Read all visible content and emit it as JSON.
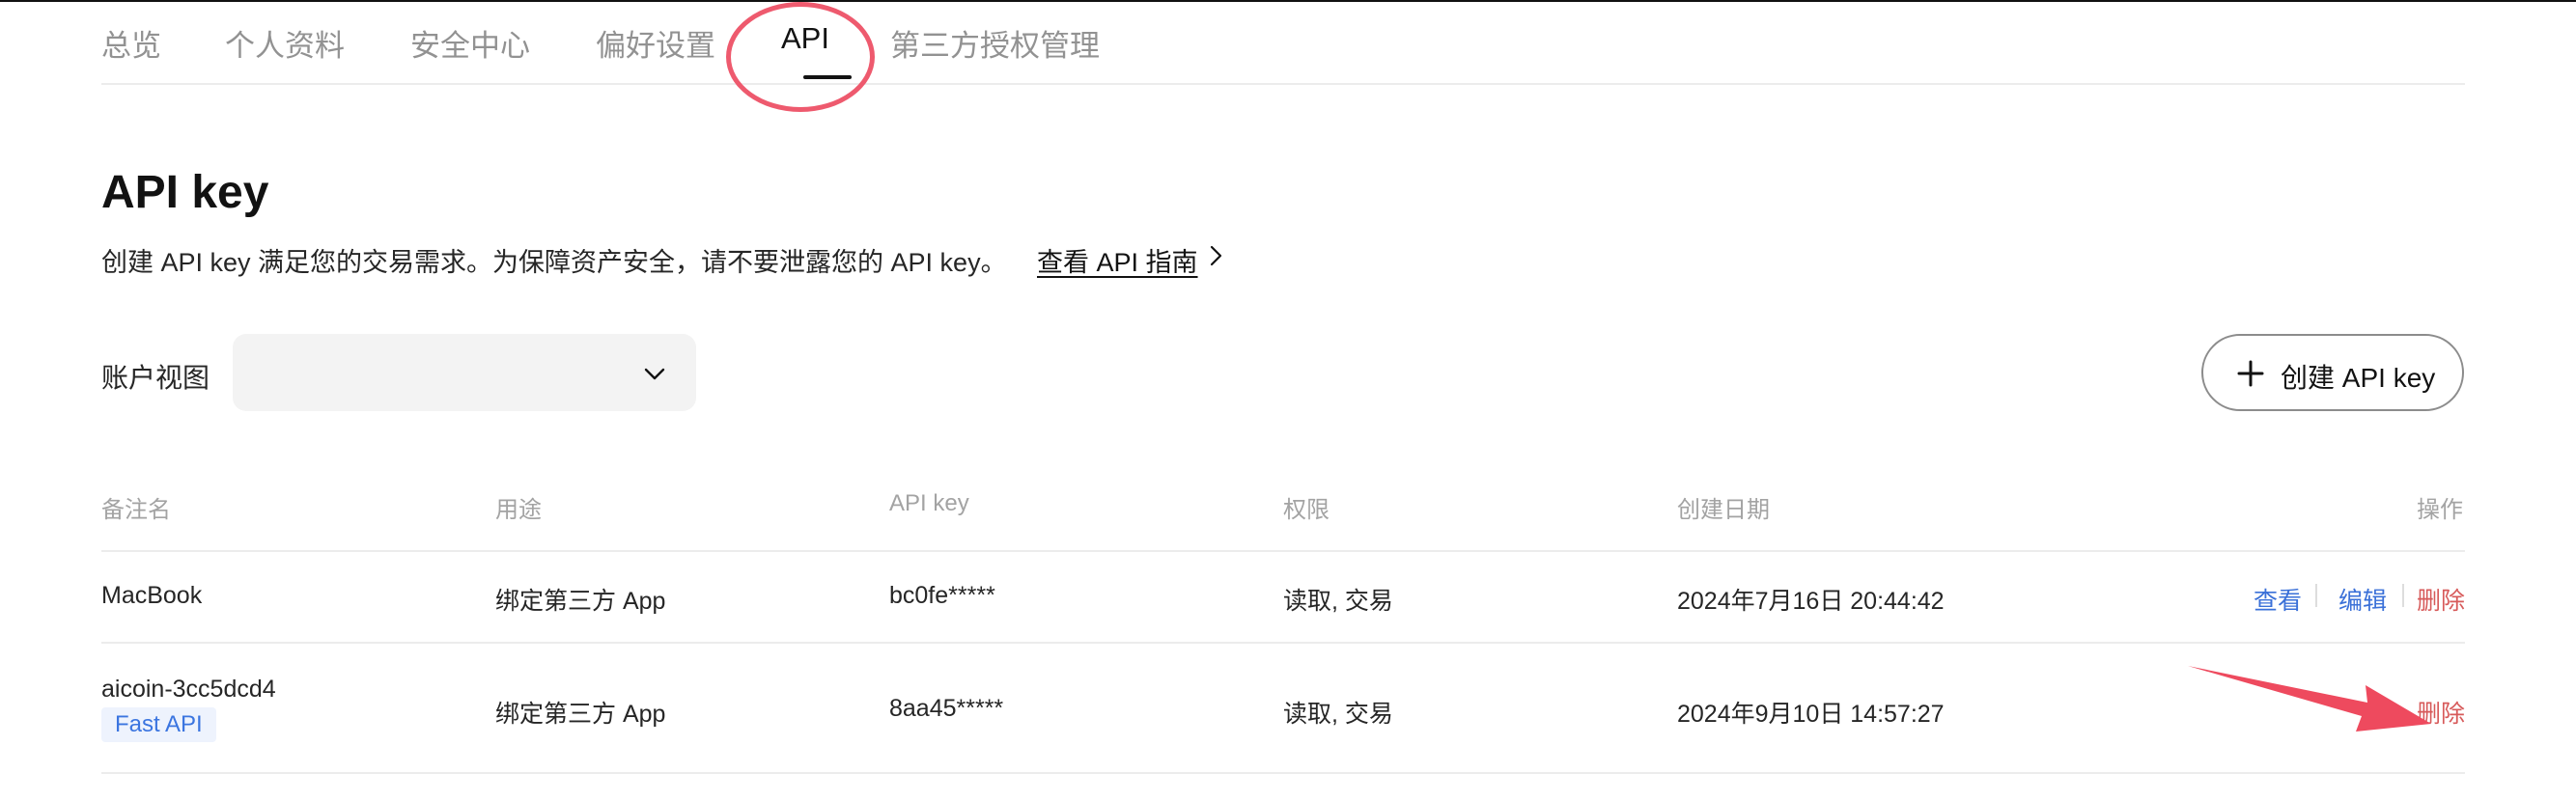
{
  "tabs": [
    {
      "label": "总览"
    },
    {
      "label": "个人资料"
    },
    {
      "label": "安全中心"
    },
    {
      "label": "偏好设置"
    },
    {
      "label": "API",
      "active": true
    },
    {
      "label": "第三方授权管理"
    }
  ],
  "header": {
    "title": "API key",
    "description": "创建 API key 满足您的交易需求。为保障资产安全，请不要泄露您的 API key。",
    "guide_link": "查看 API 指南"
  },
  "account_view": {
    "label": "账户视图",
    "selected": ""
  },
  "create_button": {
    "label": "创建 API key"
  },
  "table": {
    "columns": [
      "备注名",
      "用途",
      "API key",
      "权限",
      "创建日期",
      "操作"
    ],
    "rows": [
      {
        "name": "MacBook",
        "tag": "",
        "usage": "绑定第三方 App",
        "api_key": "bc0fe*****",
        "permissions": "读取, 交易",
        "created": "2024年7月16日 20:44:42",
        "actions": {
          "view": "查看",
          "edit": "编辑",
          "delete": "删除"
        }
      },
      {
        "name": "aicoin-3cc5dcd4",
        "tag": "Fast API",
        "usage": "绑定第三方 App",
        "api_key": "8aa45*****",
        "permissions": "读取, 交易",
        "created": "2024年9月10日 14:57:27",
        "actions": {
          "delete": "删除"
        }
      }
    ]
  },
  "icons": {
    "guide": "chevron-right-icon",
    "select": "chevron-down-icon",
    "create": "plus-icon"
  },
  "colors": {
    "link_blue": "#3a70d8",
    "delete_red": "#d75a5a",
    "tag_blue": "#3b75e0",
    "annotation_red": "#ee5a6e"
  }
}
